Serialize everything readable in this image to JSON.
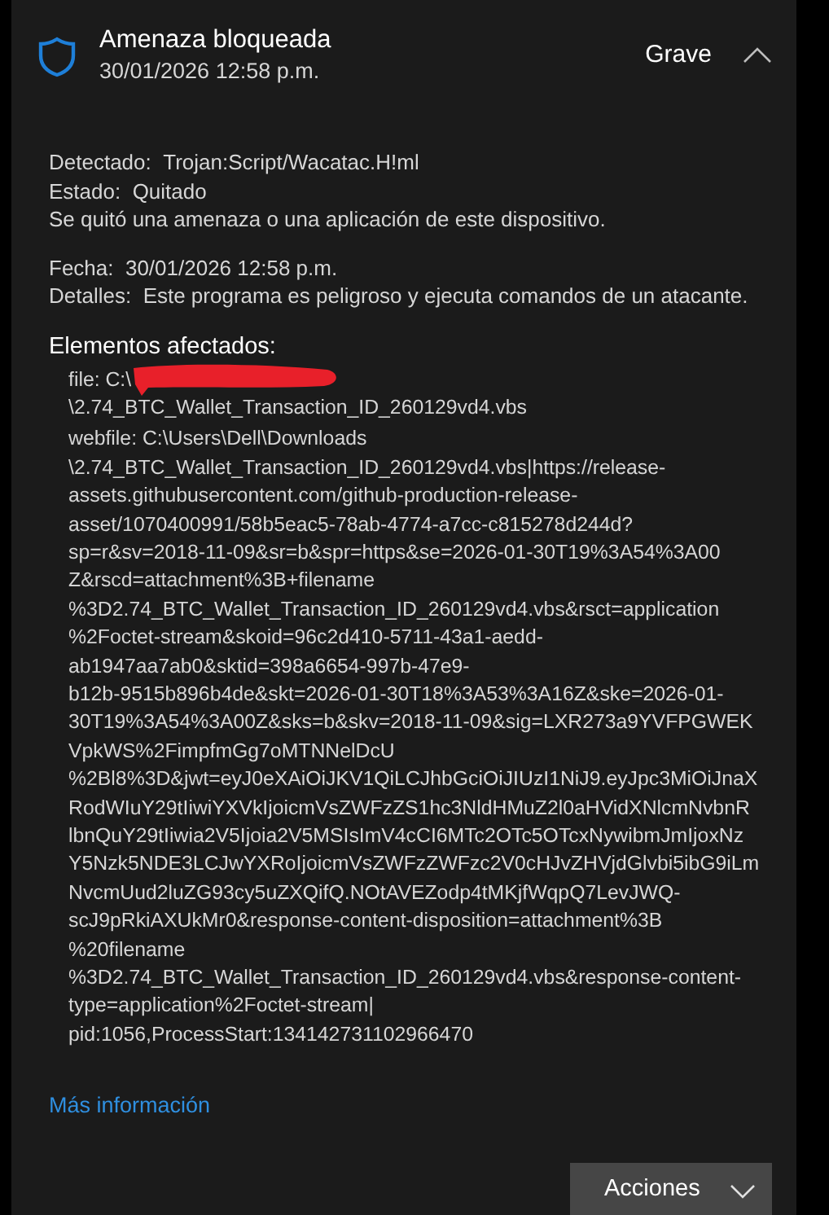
{
  "header": {
    "title": "Amenaza bloqueada",
    "date": "30/01/2026 12:58 p.m.",
    "severity": "Grave",
    "expanded": true
  },
  "info_groups": [
    {
      "lines": [
        {
          "label": "Detectado:",
          "value": "Trojan:Script/Wacatac.H!ml"
        },
        {
          "label": "Estado:",
          "value": "Quitado"
        },
        {
          "value": "Se quitó una amenaza o una aplicación de este dispositivo."
        }
      ]
    },
    {
      "lines": [
        {
          "label": "Fecha:",
          "value": "30/01/2026 12:58 p.m."
        },
        {
          "label": "Detalles:",
          "value": "Este programa es peligroso y ejecuta comandos de un atacante."
        }
      ]
    }
  ],
  "affected": {
    "heading": "Elementos afectados:",
    "items": [
      {
        "redacted": true,
        "lines": [
          "file: C:\\",
          "\\2.74_BTC_Wallet_Transaction_ID_260129vd4.vbs"
        ]
      },
      {
        "redacted": false,
        "lines": [
          "webfile: C:\\Users\\Dell\\Downloads",
          "\\2.74_BTC_Wallet_Transaction_ID_260129vd4.vbs|https://release-",
          "assets.githubusercontent.com/github-production-release-",
          "asset/1070400991/58b5eac5-78ab-4774-a7cc-c815278d244d?",
          "sp=r&sv=2018-11-09&sr=b&spr=https&se=2026-01-30T19%3A54%3A00",
          "Z&rscd=attachment%3B+filename",
          "%3D2.74_BTC_Wallet_Transaction_ID_260129vd4.vbs&rsct=application",
          "%2Foctet-stream&skoid=96c2d410-5711-43a1-aedd-",
          "ab1947aa7ab0&sktid=398a6654-997b-47e9-",
          "b12b-9515b896b4de&skt=2026-01-30T18%3A53%3A16Z&ske=2026-01-",
          "30T19%3A54%3A00Z&sks=b&skv=2018-11-09&sig=LXR273a9YVFPGWEK",
          "VpkWS%2FimpfmGg7oMTNNelDcU",
          "%2Bl8%3D&jwt=eyJ0eXAiOiJKV1QiLCJhbGciOiJIUzI1NiJ9.eyJpc3MiOiJnaX",
          "RodWIuY29tIiwiYXVkIjoicmVsZWFzZS1hc3NldHMuZ2l0aHVidXNlcmNvbnR",
          "lbnQuY29tIiwia2V5Ijoia2V5MSIsImV4cCI6MTc2OTc5OTcxNywibmJmIjoxNz",
          "Y5Nzk5NDE3LCJwYXRoIjoicmVsZWFzZWFzc2V0cHJvZHVjdGlvbi5ibG9iLm",
          "NvcmUud2luZG93cy5uZXQifQ.NOtAVEZodp4tMKjfWqpQ7LevJWQ-",
          "scJ9pRkiAXUkMr0&response-content-disposition=attachment%3B",
          "%20filename",
          "%3D2.74_BTC_Wallet_Transaction_ID_260129vd4.vbs&response-content-",
          "type=application%2Foctet-stream|",
          "pid:1056,ProcessStart:134142731102966470"
        ]
      }
    ]
  },
  "more_info_link": "Más información",
  "actions_button": "Acciones"
}
